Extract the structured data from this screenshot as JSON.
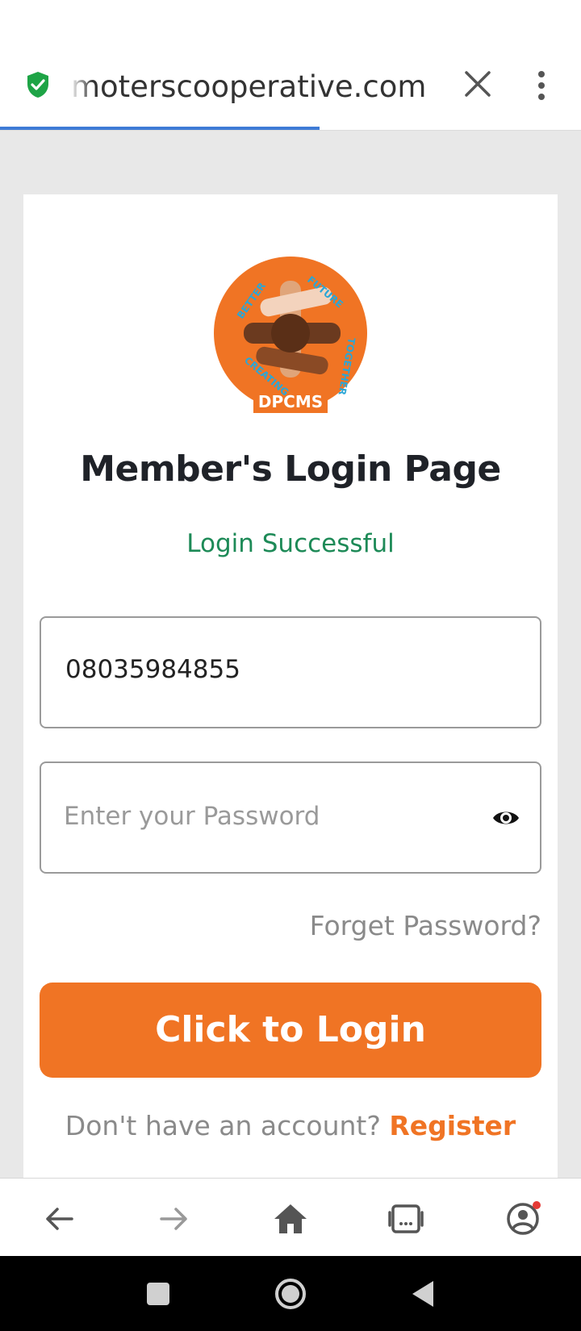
{
  "browser": {
    "url": "moterscooperative.com",
    "load_progress": 0.55
  },
  "page": {
    "logo": {
      "words": [
        "BETTER",
        "FUTURE",
        "TOGETHER",
        "CREATING"
      ],
      "brand": "DPCMS",
      "colors": {
        "circle": "#f07424",
        "text": "#2aa6d6"
      }
    },
    "title": "Member's Login Page",
    "status_message": "Login Successful",
    "phone_value": "08035984855",
    "password_placeholder": "Enter your Password",
    "forgot_password": "Forget Password?",
    "login_button": "Click to Login",
    "no_account_text": "Don't have an account?",
    "register_link": "Register"
  },
  "bottom_nav": [
    "back-icon",
    "forward-icon",
    "home-icon",
    "tabs-icon",
    "account-icon"
  ],
  "system_nav": [
    "recents-icon",
    "home-circle-icon",
    "back-triangle-icon"
  ],
  "colors": {
    "accent": "#f07424",
    "success": "#1d8a57",
    "progress": "#3e7bd6"
  }
}
